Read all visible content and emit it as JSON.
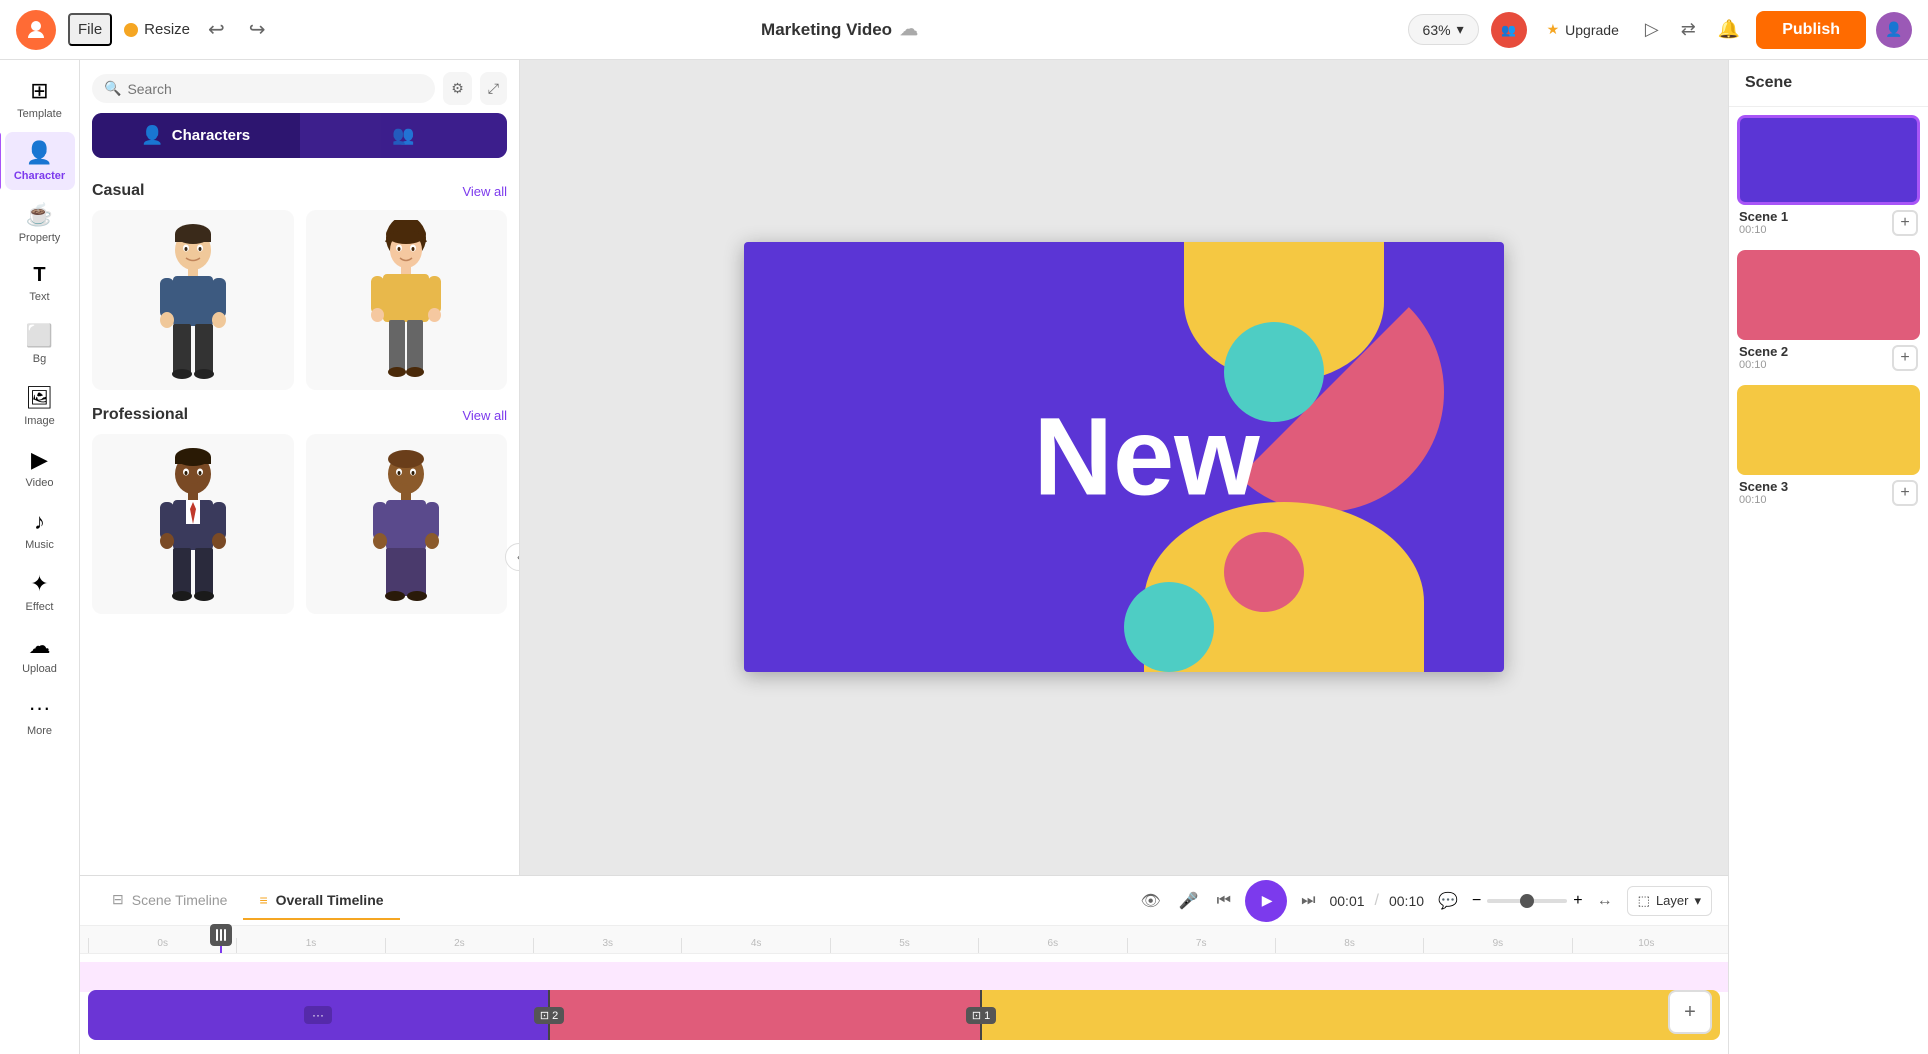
{
  "topbar": {
    "file_label": "File",
    "resize_label": "Resize",
    "title": "Marketing Video",
    "zoom": "63%",
    "upgrade_label": "Upgrade",
    "publish_label": "Publish"
  },
  "sidebar": {
    "items": [
      {
        "id": "template",
        "label": "Template",
        "icon": "⊞"
      },
      {
        "id": "character",
        "label": "Character",
        "icon": "👤",
        "active": true
      },
      {
        "id": "property",
        "label": "Property",
        "icon": "☕"
      },
      {
        "id": "text",
        "label": "Text",
        "icon": "T"
      },
      {
        "id": "bg",
        "label": "Bg",
        "icon": "⬜"
      },
      {
        "id": "image",
        "label": "Image",
        "icon": "🖼"
      },
      {
        "id": "video",
        "label": "Video",
        "icon": "▶"
      },
      {
        "id": "music",
        "label": "Music",
        "icon": "♪"
      },
      {
        "id": "effect",
        "label": "Effect",
        "icon": "✦"
      },
      {
        "id": "upload",
        "label": "Upload",
        "icon": "☁"
      },
      {
        "id": "more",
        "label": "More",
        "icon": "···"
      }
    ]
  },
  "panel": {
    "search_placeholder": "Search",
    "tabs": [
      {
        "id": "characters",
        "label": "Characters",
        "icon": "👤",
        "active": true
      },
      {
        "id": "add",
        "label": "",
        "icon": "👤+"
      }
    ],
    "categories": [
      {
        "id": "casual",
        "title": "Casual",
        "view_all": "View all",
        "characters": [
          {
            "id": "casual-male",
            "type": "male"
          },
          {
            "id": "casual-female",
            "type": "female"
          }
        ]
      },
      {
        "id": "professional",
        "title": "Professional",
        "view_all": "View all",
        "characters": [
          {
            "id": "prof-male",
            "type": "male-dark"
          },
          {
            "id": "prof-female",
            "type": "female-dark"
          }
        ]
      }
    ]
  },
  "canvas": {
    "text": "New"
  },
  "scenes": {
    "header": "Scene",
    "items": [
      {
        "id": "scene1",
        "label": "Scene 1",
        "time": "00:10",
        "color": "purple",
        "selected": true
      },
      {
        "id": "scene2",
        "label": "Scene 2",
        "time": "00:10",
        "color": "pink"
      },
      {
        "id": "scene3",
        "label": "Scene 3",
        "time": "00:10",
        "color": "yellow"
      }
    ]
  },
  "timeline": {
    "scene_tab": "Scene Timeline",
    "overall_tab": "Overall Timeline",
    "current_time": "00:01",
    "total_time": "00:10",
    "layer_label": "Layer",
    "ruler_marks": [
      "0s",
      "1s",
      "2s",
      "3s",
      "4s",
      "5s",
      "6s",
      "7s",
      "8s",
      "9s",
      "10s"
    ],
    "blocks": [
      {
        "id": "block1",
        "color": "purple",
        "badge": "···"
      },
      {
        "id": "block2",
        "color": "pink",
        "badge": "2"
      },
      {
        "id": "block3",
        "color": "yellow",
        "badge": "1"
      }
    ]
  }
}
